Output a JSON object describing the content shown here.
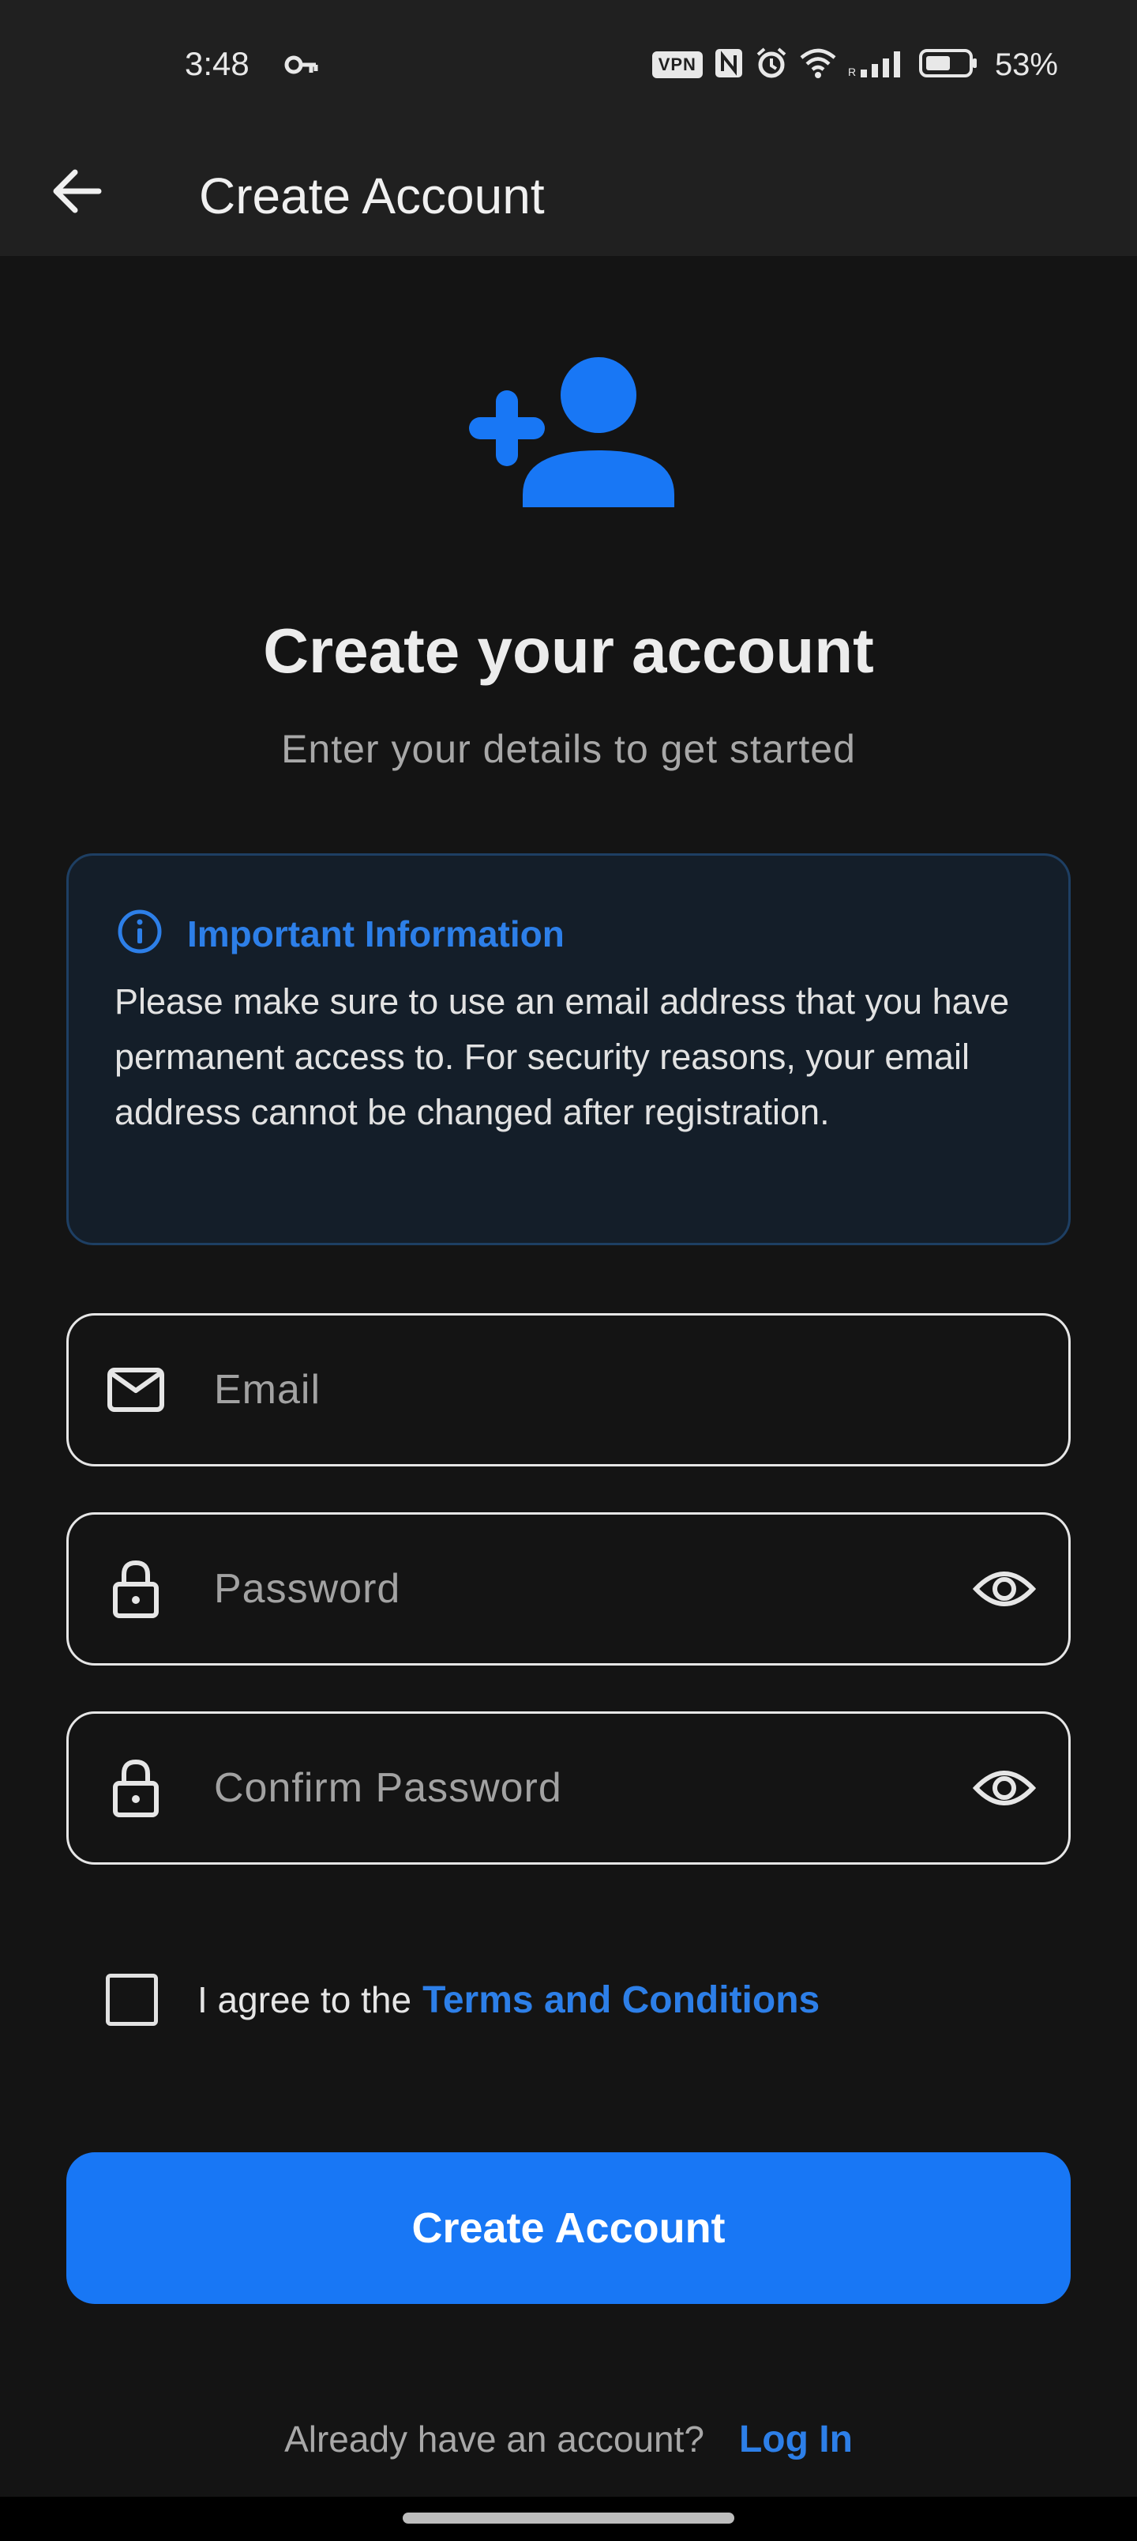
{
  "status_bar": {
    "time": "3:48",
    "vpn": "VPN",
    "battery_pct": "53%",
    "icons": [
      "key-icon",
      "nfc-icon",
      "alarm-icon",
      "wifi-icon",
      "signal-icon",
      "battery-icon"
    ]
  },
  "app_bar": {
    "title": "Create Account",
    "back_icon": "arrow-left-icon"
  },
  "hero": {
    "icon": "person-add-icon",
    "title": "Create your account",
    "subtitle": "Enter your details to get started"
  },
  "info_card": {
    "icon": "info-icon",
    "title": "Important Information",
    "body": "Please make sure to use an email address that you have permanent access to. For security reasons, your email address cannot be changed after registration."
  },
  "form": {
    "email": {
      "placeholder": "Email",
      "value": "",
      "icon": "mail-icon"
    },
    "password": {
      "placeholder": "Password",
      "value": "",
      "icon": "lock-icon",
      "toggle_icon": "eye-icon"
    },
    "confirm_password": {
      "placeholder": "Confirm Password",
      "value": "",
      "icon": "lock-icon",
      "toggle_icon": "eye-icon"
    }
  },
  "terms": {
    "checked": false,
    "text": "I agree to the",
    "link": "Terms and Conditions"
  },
  "submit": {
    "label": "Create Account"
  },
  "login": {
    "question": "Already have an account?",
    "link": "Log In"
  },
  "colors": {
    "accent": "#1877f5",
    "link": "#2d7fe8",
    "background": "#141414",
    "app_bar": "#202020",
    "info_bg": "#141e29",
    "info_border": "#1e3f63"
  }
}
